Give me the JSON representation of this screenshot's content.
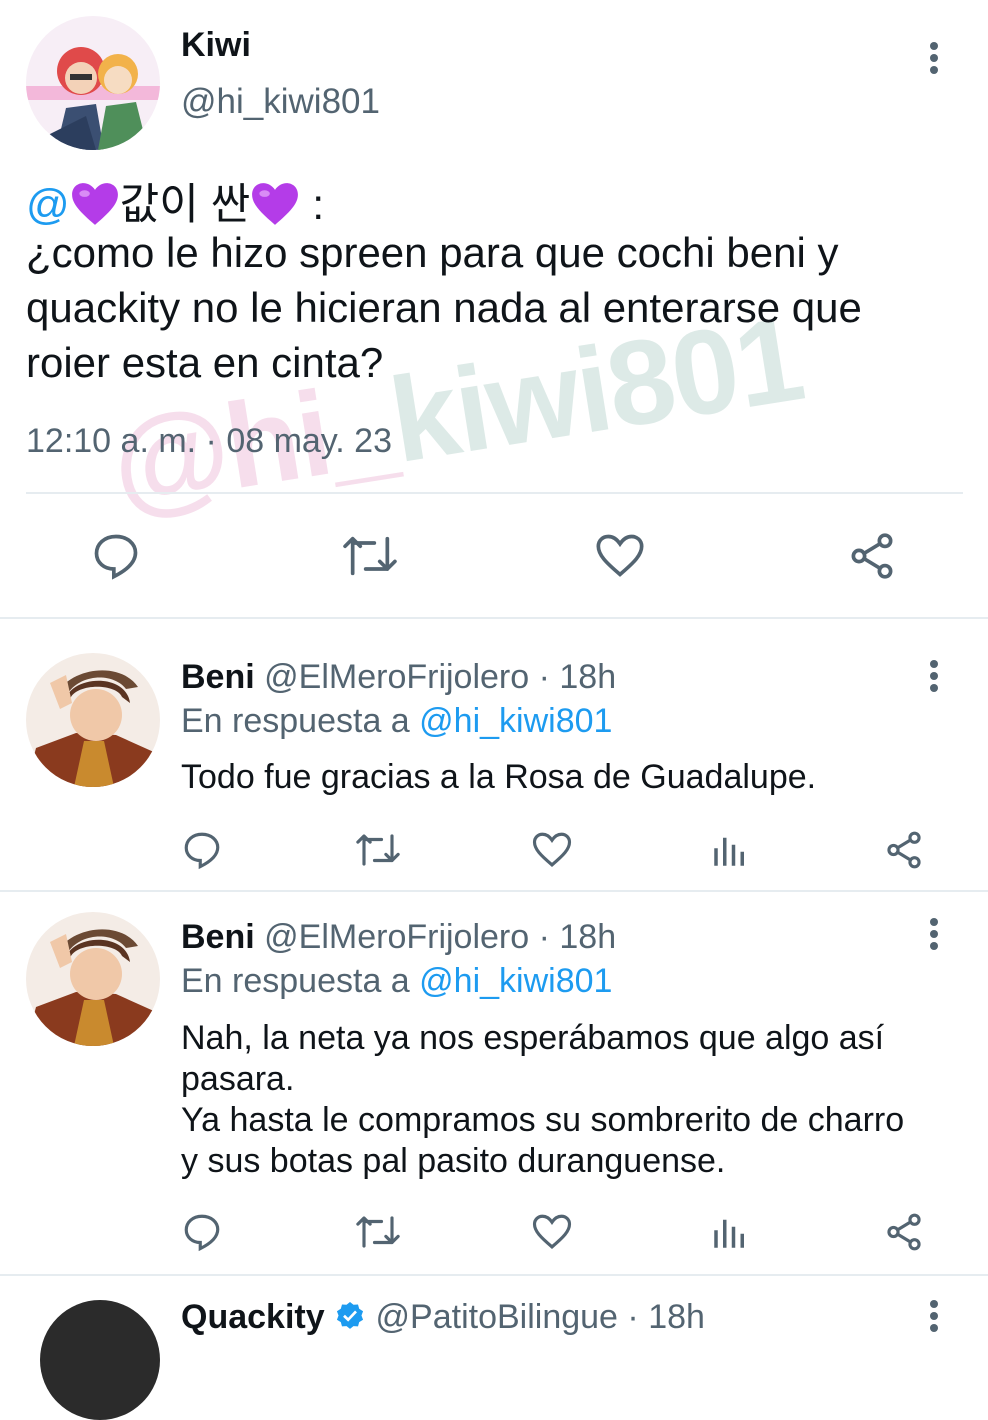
{
  "main_tweet": {
    "author_name": "Kiwi",
    "author_handle": "@hi_kiwi801",
    "mention_prefix": "@",
    "mention_korean_1": "값이 싼",
    "mention_suffix": " :",
    "body_text": "¿como le hizo spreen para que cochi beni y quackity no le hicieran nada al enterarse que roier esta en cinta?",
    "timestamp": "12:10 a. m. · 08 may. 23"
  },
  "watermark": {
    "part_a": "@hi_",
    "part_b": "kiwi801"
  },
  "replies": [
    {
      "author_name": "Beni",
      "author_handle": "@ElMeroFrijolero",
      "time": "· 18h",
      "reply_to_prefix": "En respuesta a",
      "reply_to_handle": "@hi_kiwi801",
      "text_lines": [
        "Todo fue gracias a la Rosa de Guadalupe."
      ]
    },
    {
      "author_name": "Beni",
      "author_handle": "@ElMeroFrijolero",
      "time": "· 18h",
      "reply_to_prefix": "En respuesta a",
      "reply_to_handle": "@hi_kiwi801",
      "text_lines": [
        "Nah, la neta ya nos esperábamos que algo así",
        "pasara.",
        "Ya hasta le compramos su sombrerito de charro",
        "y sus botas pal pasito duranguense."
      ]
    }
  ],
  "partial_next_reply": {
    "author_name_visible": "Quackity",
    "author_handle_visible": "@PatitoBilingue",
    "time_visible": "· 18h"
  },
  "colors": {
    "link_blue": "#1d9bf0",
    "secondary_gray": "#536471",
    "heart_purple": "#b43ce8"
  },
  "icons": [
    "reply-icon",
    "retweet-icon",
    "like-icon",
    "analytics-icon",
    "share-icon",
    "more-options-icon",
    "verified-badge-icon"
  ]
}
